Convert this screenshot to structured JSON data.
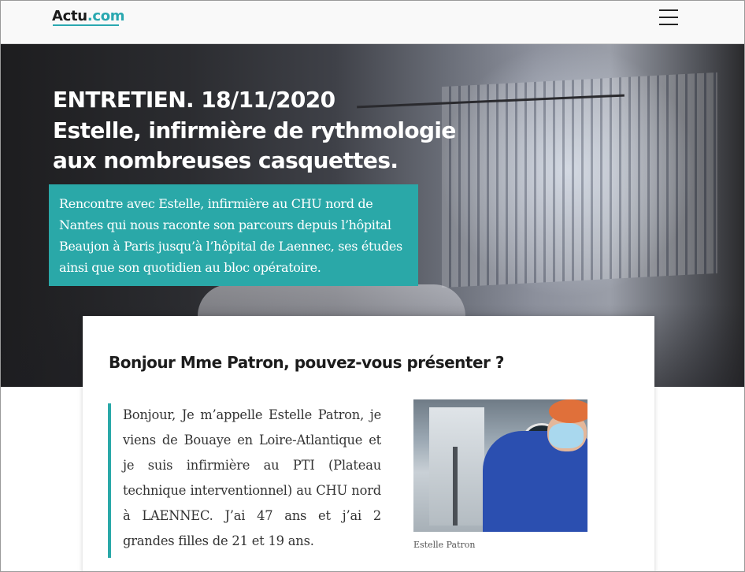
{
  "header": {
    "logo_part1": "Actu",
    "logo_part2": ".com",
    "menu_icon": "hamburger-menu-icon"
  },
  "hero": {
    "title_line1": "ENTRETIEN. 18/11/2020",
    "title_line2": "Estelle, infirmière de rythmologie",
    "title_line3": "aux nombreuses casquettes.",
    "intro": "Rencontre avec Estelle, infirmière au CHU nord de Nantes qui nous raconte son parcours depuis l’hôpital Beaujon à Paris jusqu’à l’hôpital de Laennec, ses études ainsi que son quotidien au bloc opératoire."
  },
  "article": {
    "question": "Bonjour Mme Patron, pouvez-vous présenter ?",
    "answer": "Bonjour, Je m’appelle Estelle Patron, je viens de Bouaye en Loire-Atlantique  et je suis infirmière au PTI (Plateau technique interventionnel) au CHU nord à LAENNEC. J’ai 47 ans et j’ai 2 grandes filles de 21 et 19 ans.",
    "photo_caption": "Estelle Patron"
  },
  "colors": {
    "accent": "#2aa8a8",
    "logo_accent": "#2aa8b0",
    "text_dark": "#1c1c1c"
  }
}
